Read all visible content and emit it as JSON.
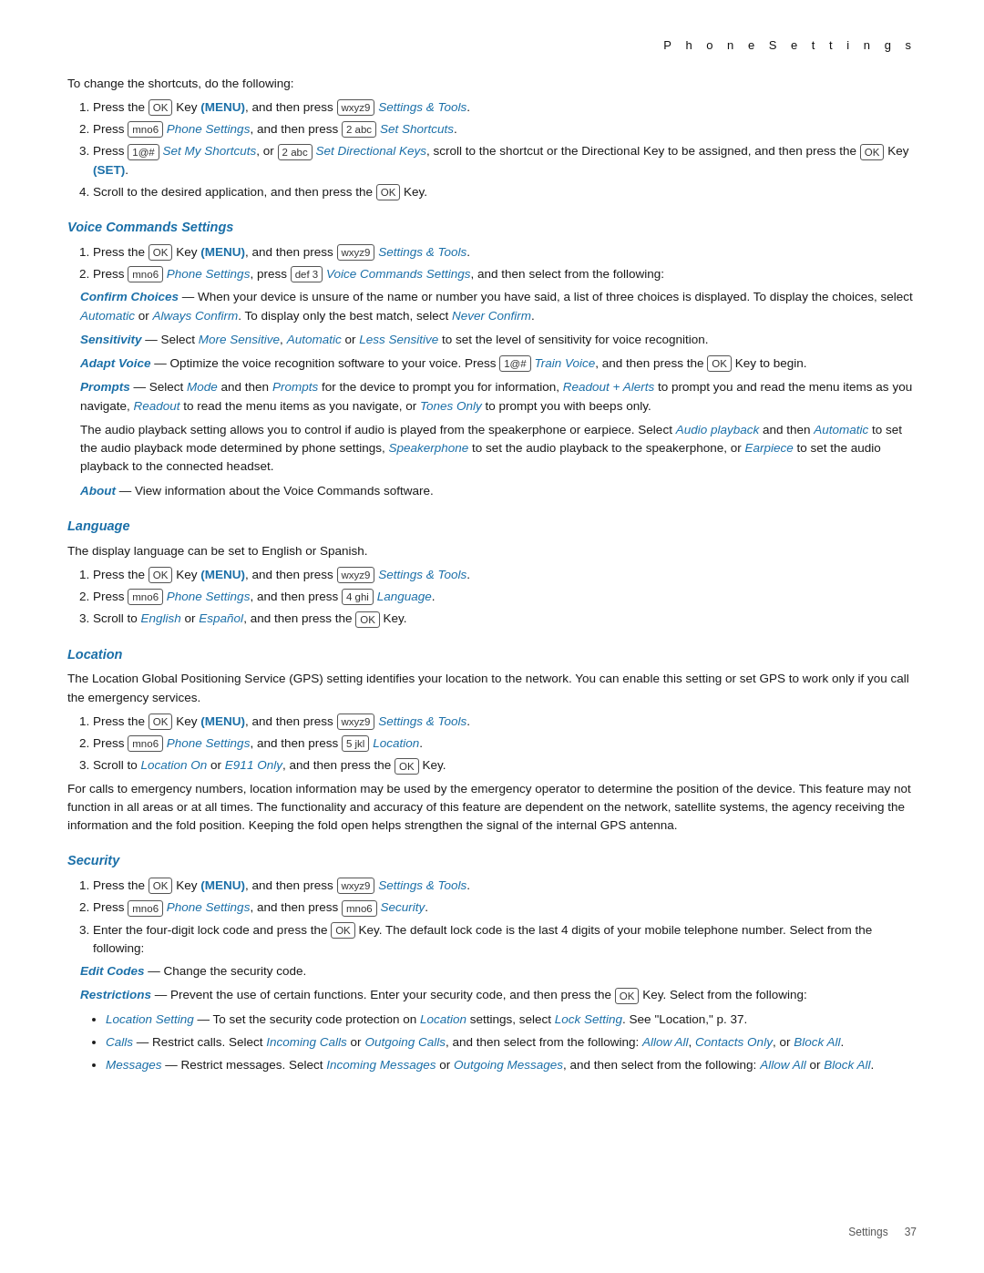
{
  "header": {
    "title": "P h o n e   S e t t i n g s"
  },
  "footer": {
    "label": "Settings",
    "page": "37"
  },
  "intro": {
    "text": "To change the shortcuts, do the following:"
  },
  "shortcuts_steps": [
    {
      "text_before": "Press the",
      "key1": "OK",
      "text_mid1": "Key",
      "bold1": "(MENU)",
      "text_mid2": ", and then press",
      "key2": "wxyz9",
      "link1": "Settings & Tools",
      "text_end": "."
    },
    {
      "text_before": "Press",
      "key1": "mno6",
      "link1": "Phone Settings",
      "text_mid1": ", and then press",
      "key2": "2 abc",
      "link2": "Set Shortcuts",
      "text_end": "."
    },
    {
      "text_before": "Press",
      "key1": "1@#",
      "link1": "Set My Shortcuts",
      "text_mid1": ", or",
      "key2": "2 abc",
      "link2": "Set Directional Keys",
      "text_end": ", scroll to the shortcut or the Directional Key to be assigned, and then press the",
      "key3": "OK",
      "text_end2": "Key",
      "bold1": "(SET)",
      "text_end3": "."
    },
    {
      "text": "Scroll to the desired application, and then press the",
      "key1": "OK",
      "text_end": "Key."
    }
  ],
  "voice_commands": {
    "heading": "Voice Commands Settings",
    "steps": [
      {
        "text_before": "Press the",
        "key1": "OK",
        "text_mid1": "Key",
        "bold1": "(MENU)",
        "text_mid2": ", and then press",
        "key2": "wxyz9",
        "link1": "Settings & Tools",
        "text_end": "."
      },
      {
        "text_before": "Press",
        "key1": "mno6",
        "link1": "Phone Settings",
        "text_mid1": ", press",
        "key2": "def 3",
        "link2": "Voice Commands Settings",
        "text_end": ", and then select from the following:"
      }
    ],
    "options": [
      {
        "heading": "Confirm Choices",
        "dash": " — When your device is unsure of the name or number you have said, a list of three choices is displayed. To display the choices, select ",
        "link1": "Automatic",
        "text1": " or ",
        "link2": "Always Confirm",
        "text2": ". To display only the best match, select ",
        "link3": "Never Confirm",
        "text3": "."
      },
      {
        "heading": "Sensitivity",
        "dash": " — Select ",
        "link1": "More Sensitive",
        "text1": ", ",
        "link2": "Automatic",
        "text2": " or ",
        "link3": "Less Sensitive",
        "text3": " to set the level of sensitivity for voice recognition."
      },
      {
        "heading": "Adapt Voice",
        "dash": " — Optimize the voice recognition software to your voice. Press",
        "key1": "1@#",
        "link1": "Train Voice",
        "text1": ", and then press the",
        "key2": "OK",
        "text2": "Key to begin."
      },
      {
        "heading": "Prompts",
        "dash": " — Select ",
        "link1": "Mode",
        "text1": " and then ",
        "link2": "Prompts",
        "text2": " for the device to prompt you for information, ",
        "link3": "Readout + Alerts",
        "text3": " to prompt you and read the menu items as you navigate, ",
        "link4": "Readout",
        "text4": " to read the menu items as you navigate, or ",
        "link5": "Tones Only",
        "text5": " to prompt you with beeps only."
      }
    ],
    "audio_para": "The audio playback setting allows you to control if audio is played from the speakerphone or earpiece. Select ",
    "audio_link1": "Audio playback",
    "audio_text1": " and then ",
    "audio_link2": "Automatic",
    "audio_text2": " to set the audio playback mode determined by phone settings, ",
    "audio_link3": "Speakerphone",
    "audio_text3": " to set the audio playback to the speakerphone, or ",
    "audio_link4": "Earpiece",
    "audio_text4": " to set the audio playback to the connected headset.",
    "about_heading": "About",
    "about_text": " — View information about the Voice Commands software."
  },
  "language": {
    "heading": "Language",
    "desc": "The display language can be set to English or Spanish.",
    "steps": [
      {
        "text_before": "Press the",
        "key1": "OK",
        "text_mid1": "Key",
        "bold1": "(MENU)",
        "text_mid2": ", and then press",
        "key2": "wxyz9",
        "link1": "Settings & Tools",
        "text_end": "."
      },
      {
        "text_before": "Press",
        "key1": "mno6",
        "link1": "Phone Settings",
        "text_mid1": ", and then press",
        "key2": "4 ghi",
        "link2": "Language",
        "text_end": "."
      },
      {
        "text_before": "Scroll to",
        "link1": "English",
        "text_mid1": " or ",
        "link2": "Español",
        "text_mid2": ", and then press the",
        "key1": "OK",
        "text_end": "Key."
      }
    ]
  },
  "location": {
    "heading": "Location",
    "desc": "The Location Global Positioning Service (GPS) setting identifies your location to the network. You can enable this setting or set GPS to work only if you call the emergency services.",
    "steps": [
      {
        "text_before": "Press the",
        "key1": "OK",
        "text_mid1": "Key",
        "bold1": "(MENU)",
        "text_mid2": ", and then press",
        "key2": "wxyz9",
        "link1": "Settings & Tools",
        "text_end": "."
      },
      {
        "text_before": "Press",
        "key1": "mno6",
        "link1": "Phone Settings",
        "text_mid1": ", and then press",
        "key2": "5 jkl",
        "link2": "Location",
        "text_end": "."
      },
      {
        "text_before": "Scroll to",
        "link1": "Location On",
        "text_mid1": " or ",
        "link2": "E911 Only",
        "text_mid2": ", and then press the",
        "key1": "OK",
        "text_end": "Key."
      }
    ],
    "para": "For calls to emergency numbers, location information may be used by the emergency operator to determine the position of the device. This feature may not function in all areas or at all times. The functionality and accuracy of this feature are dependent on the network, satellite systems, the agency receiving the information and the fold position. Keeping the fold open helps strengthen the signal of the internal GPS antenna."
  },
  "security": {
    "heading": "Security",
    "steps": [
      {
        "text_before": "Press the",
        "key1": "OK",
        "text_mid1": "Key",
        "bold1": "(MENU)",
        "text_mid2": ", and then press",
        "key2": "wxyz9",
        "link1": "Settings & Tools",
        "text_end": "."
      },
      {
        "text_before": "Press",
        "key1": "mno6",
        "link1": "Phone Settings",
        "text_mid1": ", and then press",
        "key2": "mno6",
        "link2": "Security",
        "text_end": "."
      },
      {
        "text": "Enter the four-digit lock code and press the",
        "key1": "OK",
        "text_mid": "Key. The default lock code is the last 4 digits of your mobile telephone number. Select from the following:"
      }
    ],
    "edit_codes_heading": "Edit Codes",
    "edit_codes_text": " — Change the security code.",
    "restrictions_heading": "Restrictions",
    "restrictions_text": " — Prevent the use of certain functions. Enter your security code, and then press the",
    "restrictions_key": "OK",
    "restrictions_text2": "Key. Select from the following:",
    "bullets": [
      {
        "heading": "Location Setting",
        "text1": " — To set the security code protection on ",
        "link1": "Location",
        "text2": " settings, select ",
        "link2": "Lock Setting",
        "text3": ". See \"Location,\" p. 37."
      },
      {
        "heading": "Calls",
        "text1": " — Restrict calls. Select ",
        "link1": "Incoming Calls",
        "text2": " or ",
        "link2": "Outgoing Calls",
        "text3": ", and then select from the following: ",
        "link3": "Allow All",
        "text4": ", ",
        "link4": "Contacts Only",
        "text5": ", or ",
        "link5": "Block All",
        "text6": "."
      },
      {
        "heading": "Messages",
        "text1": " — Restrict messages. Select ",
        "link1": "Incoming Messages",
        "text2": " or ",
        "link2": "Outgoing Messages",
        "text3": ", and then select from the following: ",
        "link3": "Allow All",
        "text4": " or ",
        "link4": "Block All",
        "text5": "."
      }
    ]
  }
}
